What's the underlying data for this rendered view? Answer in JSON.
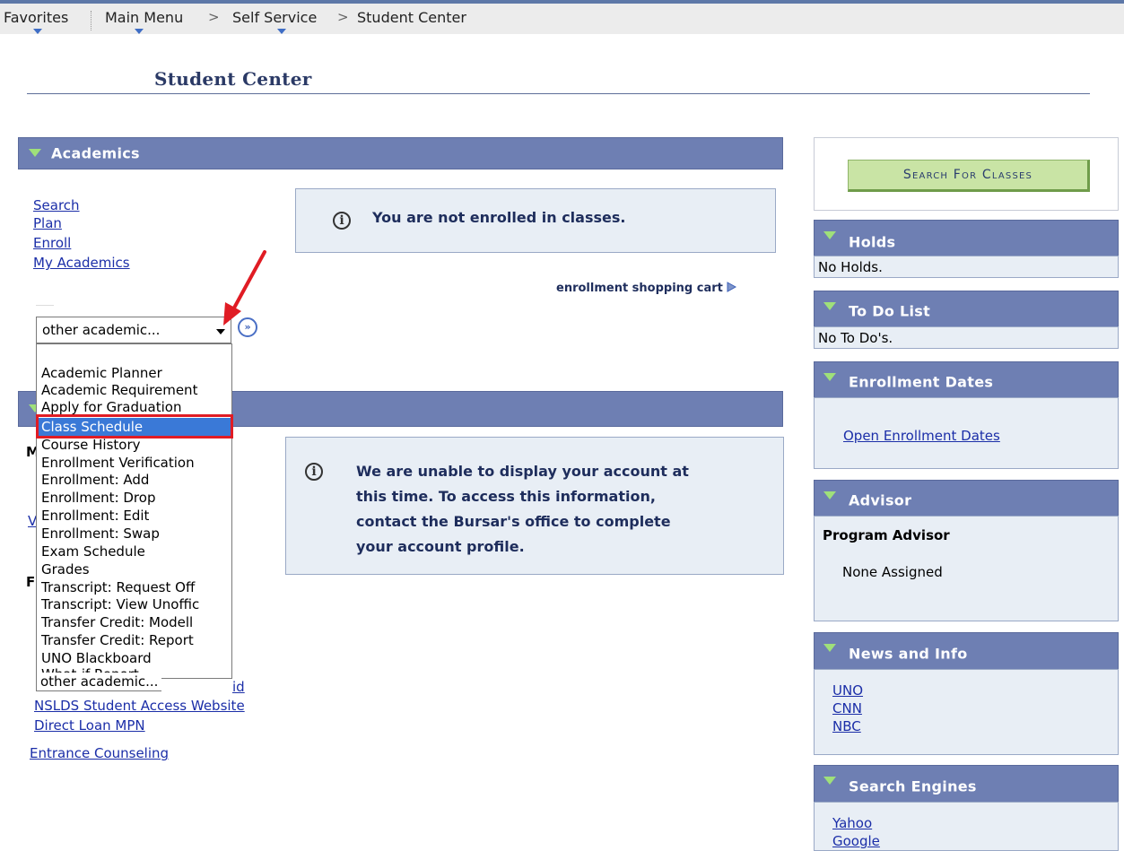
{
  "nav": {
    "favorites": "Favorites",
    "main_menu": "Main Menu",
    "self_service": "Self Service",
    "student_center": "Student Center",
    "separator": ">"
  },
  "page_title": "Student Center",
  "academics": {
    "header": "Academics",
    "links": [
      "Search",
      "Plan",
      "Enroll",
      "My Academics"
    ],
    "not_enrolled": "You are not enrolled in classes.",
    "shopping_cart": "enrollment shopping cart",
    "select_value": "other academic...",
    "dropdown_options": [
      "Academic Planner",
      "Academic Requirement",
      "Apply for Graduation",
      "Class Schedule",
      "Course History",
      "Enrollment Verification",
      "Enrollment: Add",
      "Enrollment: Drop",
      "Enrollment: Edit",
      "Enrollment: Swap",
      "Exam Schedule",
      "Grades",
      "Transcript: Request Off",
      "Transcript: View Unoffic",
      "Transfer Credit: Modell",
      "Transfer Credit: Report",
      "UNO Blackboard",
      "What-if Report",
      "other academic..."
    ],
    "selected_option": "Class Schedule"
  },
  "finances": {
    "header": "",
    "account_message": "We are unable to display your account at this time.  To access this information, contact the Bursar's office to complete your account profile.",
    "account_message_lines": [
      "We are unable to display your account at",
      "this time.  To access this information,",
      "contact the Bursar's office to complete",
      "your account profile."
    ],
    "partial_link_1": "id",
    "nslds_link": "NSLDS Student Access Website",
    "direct_loan_link": "Direct Loan MPN",
    "entrance_link": "Entrance Counseling",
    "left_fragments": [
      "M",
      "V",
      "F"
    ]
  },
  "right": {
    "search_button": "Search For Classes",
    "holds": {
      "header": "Holds",
      "text": "No Holds."
    },
    "todo": {
      "header": "To Do List",
      "text": "No To Do's."
    },
    "enrollment_dates": {
      "header": "Enrollment Dates",
      "link": "Open Enrollment Dates"
    },
    "advisor": {
      "header": "Advisor",
      "label": "Program Advisor",
      "value": "None Assigned"
    },
    "news": {
      "header": "News and Info",
      "links": [
        "UNO",
        "CNN",
        "NBC"
      ]
    },
    "search_engines": {
      "header": "Search Engines",
      "links": [
        "Yahoo",
        "Google"
      ]
    }
  },
  "colors": {
    "header_bg": "#6e7fb3",
    "info_bg": "#e8eef5",
    "link": "#1b2ea8",
    "selected_option_bg": "#3a79d7",
    "highlight_outline": "#e01c24",
    "search_button_bg": "#c9e4a5",
    "annotation_arrow": "#e01c24"
  }
}
